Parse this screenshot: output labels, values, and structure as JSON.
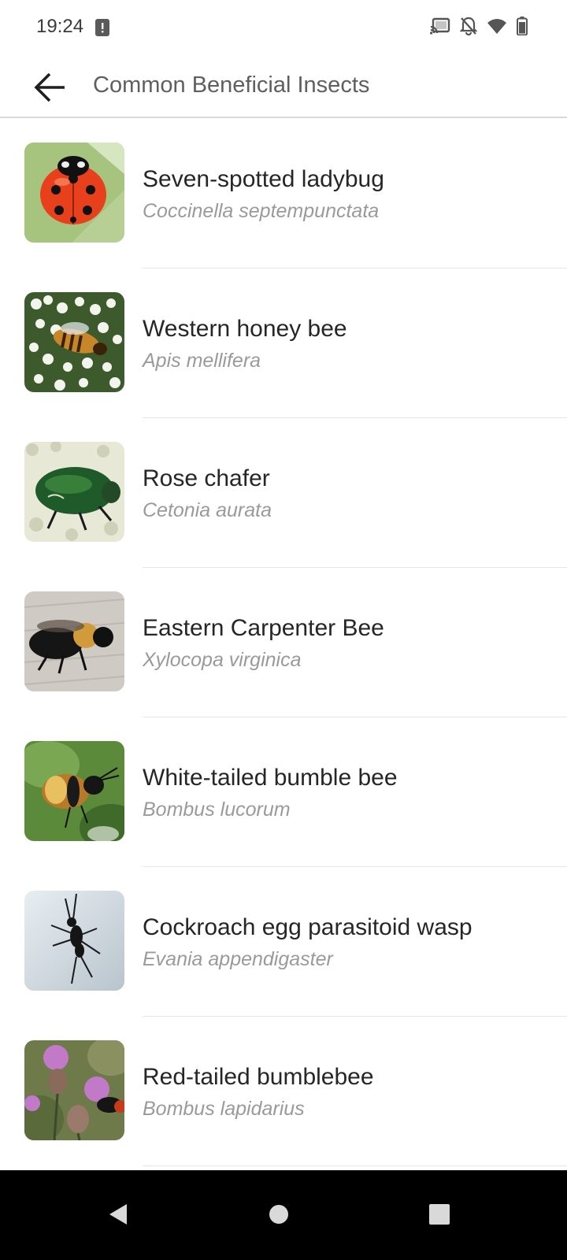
{
  "status_bar": {
    "time": "19:24",
    "icons": [
      "alert-icon",
      "cast-icon",
      "notifications-off-icon",
      "wifi-icon",
      "battery-icon"
    ]
  },
  "app_bar": {
    "title": "Common Beneficial Insects",
    "back_icon": "arrow-back-icon"
  },
  "insects": [
    {
      "common_name": "Seven-spotted ladybug",
      "scientific_name": "Coccinella septempunctata",
      "image": "ladybug-photo"
    },
    {
      "common_name": "Western honey bee",
      "scientific_name": "Apis mellifera",
      "image": "honey-bee-photo"
    },
    {
      "common_name": "Rose chafer",
      "scientific_name": "Cetonia aurata",
      "image": "rose-chafer-photo"
    },
    {
      "common_name": "Eastern Carpenter Bee",
      "scientific_name": "Xylocopa virginica",
      "image": "carpenter-bee-photo"
    },
    {
      "common_name": "White-tailed bumble bee",
      "scientific_name": "Bombus lucorum",
      "image": "bumble-bee-photo"
    },
    {
      "common_name": "Cockroach egg parasitoid wasp",
      "scientific_name": "Evania appendigaster",
      "image": "parasitoid-wasp-photo"
    },
    {
      "common_name": "Red-tailed bumblebee",
      "scientific_name": "Bombus lapidarius",
      "image": "red-tailed-bumblebee-photo"
    }
  ],
  "nav_bar": {
    "buttons": [
      "nav-back-icon",
      "nav-home-icon",
      "nav-recents-icon"
    ]
  },
  "colors": {
    "title_text": "#5f5f5f",
    "primary_text": "#262626",
    "secondary_text": "#9a9a9a",
    "divider": "#e6e6e6"
  }
}
